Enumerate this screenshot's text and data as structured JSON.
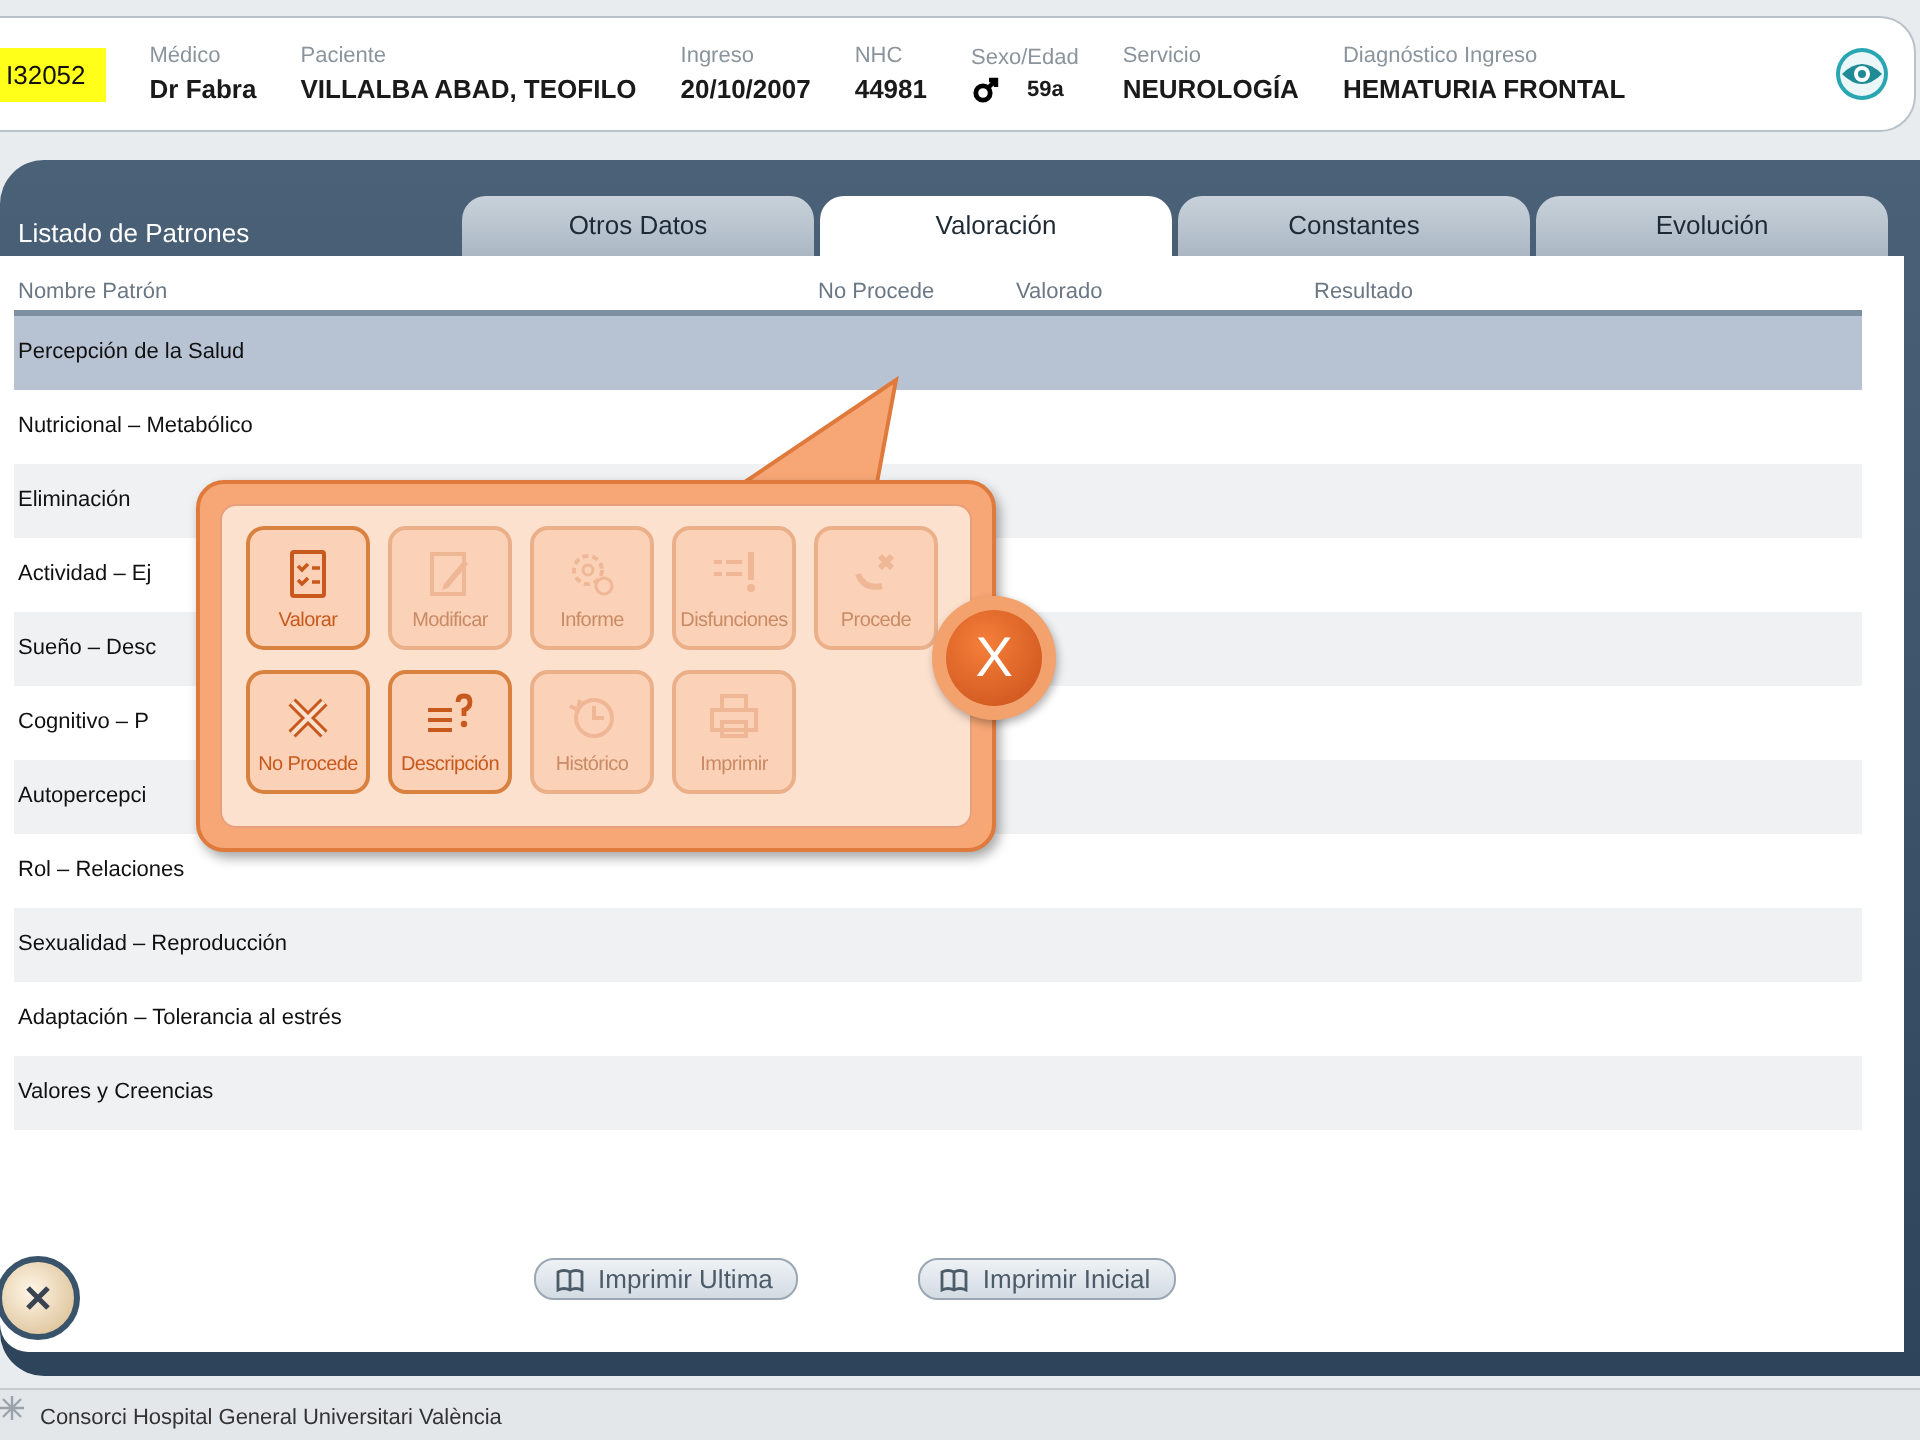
{
  "header": {
    "id_badge": "I32052",
    "fields": [
      {
        "label": "Médico",
        "value": "Dr Fabra"
      },
      {
        "label": "Paciente",
        "value": "VILLALBA ABAD, TEOFILO"
      },
      {
        "label": "Ingreso",
        "value": "20/10/2007"
      },
      {
        "label": "NHC",
        "value": "44981"
      },
      {
        "label": "Sexo/Edad",
        "value": "59a",
        "kind": "sex"
      },
      {
        "label": "Servicio",
        "value": "NEUROLOGÍA"
      },
      {
        "label": "Diagnóstico Ingreso",
        "value": "HEMATURIA FRONTAL"
      }
    ]
  },
  "panel": {
    "title": "Listado de Patrones",
    "tabs": [
      {
        "label": "Otros Datos",
        "selected": false
      },
      {
        "label": "Valoración",
        "selected": true
      },
      {
        "label": "Constantes",
        "selected": false
      },
      {
        "label": "Evolución",
        "selected": false
      }
    ],
    "table": {
      "columns": [
        "Nombre Patrón",
        "No Procede",
        "Valorado",
        "Resultado"
      ],
      "rows": [
        {
          "name": "Percepción de la Salud",
          "selected": true
        },
        {
          "name": "Nutricional – Metabólico",
          "selected": false
        },
        {
          "name": "Eliminación",
          "selected": false
        },
        {
          "name": "Actividad – Ej",
          "selected": false
        },
        {
          "name": "Sueño – Desc",
          "selected": false
        },
        {
          "name": "Cognitivo – P",
          "selected": false
        },
        {
          "name": "Autopercepci",
          "selected": false
        },
        {
          "name": "Rol – Relaciones",
          "selected": false
        },
        {
          "name": "Sexualidad – Reproducción",
          "selected": false
        },
        {
          "name": "Adaptación – Tolerancia al estrés",
          "selected": false
        },
        {
          "name": "Valores y Creencias",
          "selected": false
        }
      ]
    },
    "buttons": [
      "Imprimir Ultima",
      "Imprimir Inicial"
    ]
  },
  "popup": {
    "close": "X",
    "actions": [
      {
        "label": "Valorar",
        "kind": "valorar",
        "disabled": false
      },
      {
        "label": "Modificar",
        "kind": "modificar",
        "disabled": true
      },
      {
        "label": "Informe",
        "kind": "informe",
        "disabled": true
      },
      {
        "label": "Disfunciones",
        "kind": "disfunciones",
        "disabled": true
      },
      {
        "label": "Procede",
        "kind": "procede",
        "disabled": true
      },
      {
        "label": "No Procede",
        "kind": "noprocede",
        "disabled": false
      },
      {
        "label": "Descripción",
        "kind": "descripcion",
        "disabled": false
      },
      {
        "label": "Histórico",
        "kind": "historico",
        "disabled": true
      },
      {
        "label": "Imprimir",
        "kind": "imprimir",
        "disabled": true
      }
    ]
  },
  "footer": {
    "text": "Consorci Hospital General Universitari València"
  }
}
